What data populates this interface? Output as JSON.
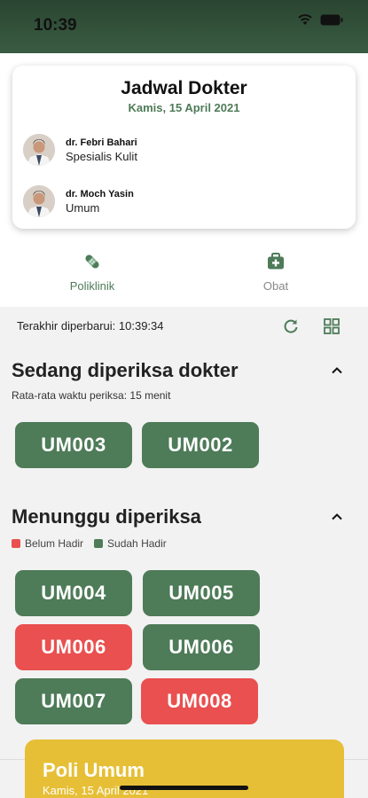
{
  "status_bar": {
    "time": "10:39"
  },
  "doctor_card": {
    "title": "Jadwal Dokter",
    "date": "Kamis, 15 April 2021",
    "doctors": [
      {
        "name": "dr. Febri Bahari",
        "specialty": "Spesialis Kulit"
      },
      {
        "name": "dr. Moch Yasin",
        "specialty": "Umum"
      }
    ]
  },
  "tabs": [
    {
      "label": "Poliklinik",
      "icon": "bandage-icon",
      "active": true
    },
    {
      "label": "Obat",
      "icon": "medkit-icon",
      "active": false
    }
  ],
  "last_updated": "Terakhir diperbarui: 10:39:34",
  "in_progress": {
    "title": "Sedang diperiksa dokter",
    "subtitle": "Rata-rata waktu periksa: 15 menit",
    "tickets": [
      {
        "code": "UM003",
        "status": "green"
      },
      {
        "code": "UM002",
        "status": "green"
      }
    ]
  },
  "waiting": {
    "title": "Menunggu diperiksa",
    "legend": {
      "absent": "Belum Hadir",
      "present": "Sudah Hadir"
    },
    "tickets": [
      {
        "code": "UM004",
        "status": "green"
      },
      {
        "code": "UM005",
        "status": "green"
      },
      {
        "code": "UM006",
        "status": "red"
      },
      {
        "code": "UM006",
        "status": "green"
      },
      {
        "code": "UM007",
        "status": "green"
      },
      {
        "code": "UM008",
        "status": "red"
      }
    ]
  },
  "poli_card": {
    "title": "Poli Umum",
    "date": "Kamis, 15 April 2021"
  },
  "colors": {
    "primary": "#4e7b58",
    "alert": "#e9504f",
    "accent": "#e6bf36",
    "header": "#2e4c35"
  }
}
